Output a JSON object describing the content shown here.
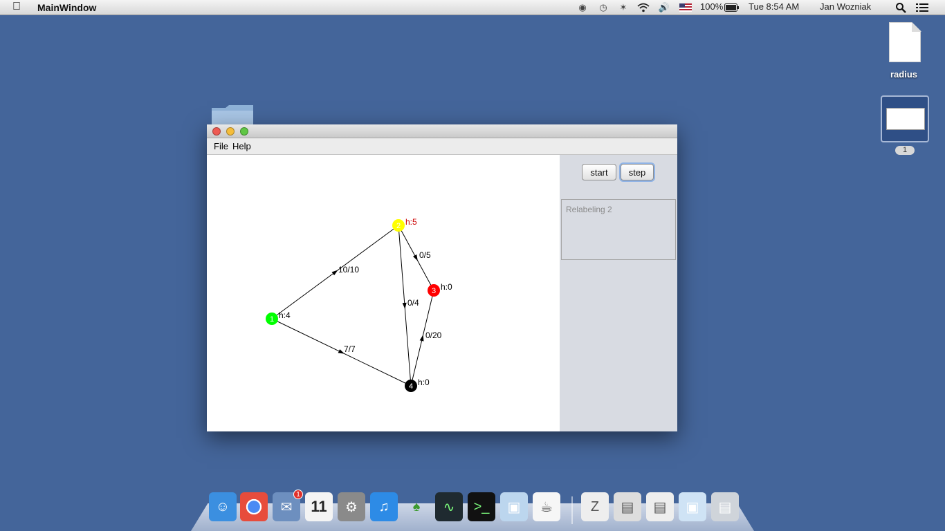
{
  "menubar": {
    "app_name": "MainWindow",
    "battery": "100%",
    "clock": "Tue 8:54 AM",
    "user": "Jan Wozniak",
    "icons": [
      "apple-icon",
      "user-icon",
      "time-machine-icon",
      "bluetooth-icon",
      "wifi-icon",
      "volume-icon",
      "flag-icon",
      "battery-icon",
      "spotlight-icon",
      "notification-center-icon"
    ]
  },
  "desktop": {
    "file_label": "radius",
    "space_badge": "1"
  },
  "window": {
    "menus": [
      "File",
      "Help"
    ],
    "buttons": {
      "start": "start",
      "step": "step"
    },
    "log_text": "Relabeling 2"
  },
  "graph": {
    "nodes": [
      {
        "id": "1",
        "label": "1",
        "color": "#00ff00",
        "height_label": "h:4"
      },
      {
        "id": "2",
        "label": "2",
        "color": "#ffff00",
        "height_label": "h:5",
        "height_color": "#cc0000"
      },
      {
        "id": "3",
        "label": "3",
        "color": "#ff0000",
        "height_label": "h:0"
      },
      {
        "id": "4",
        "label": "4",
        "color": "#000000",
        "height_label": "h:0"
      }
    ],
    "edges": [
      {
        "from": "1",
        "to": "2",
        "label": "10/10"
      },
      {
        "from": "2",
        "to": "3",
        "label": "0/5"
      },
      {
        "from": "2",
        "to": "4",
        "label": "0/4"
      },
      {
        "from": "4",
        "to": "3",
        "label": "0/20"
      },
      {
        "from": "1",
        "to": "4",
        "label": "7/7"
      }
    ]
  },
  "dock": {
    "items": [
      "finder-icon",
      "chrome-icon",
      "mail-icon",
      "calendar-icon",
      "system-preferences-icon",
      "itunes-icon",
      "app-icon",
      "activity-monitor-icon",
      "terminal-icon",
      "virtualbox-icon",
      "java-icon",
      "zip-stack-icon",
      "documents-stack-icon",
      "downloads-stack-icon",
      "cube-icon",
      "trash-icon"
    ],
    "mail_badge": "1",
    "calendar_day": "11"
  }
}
